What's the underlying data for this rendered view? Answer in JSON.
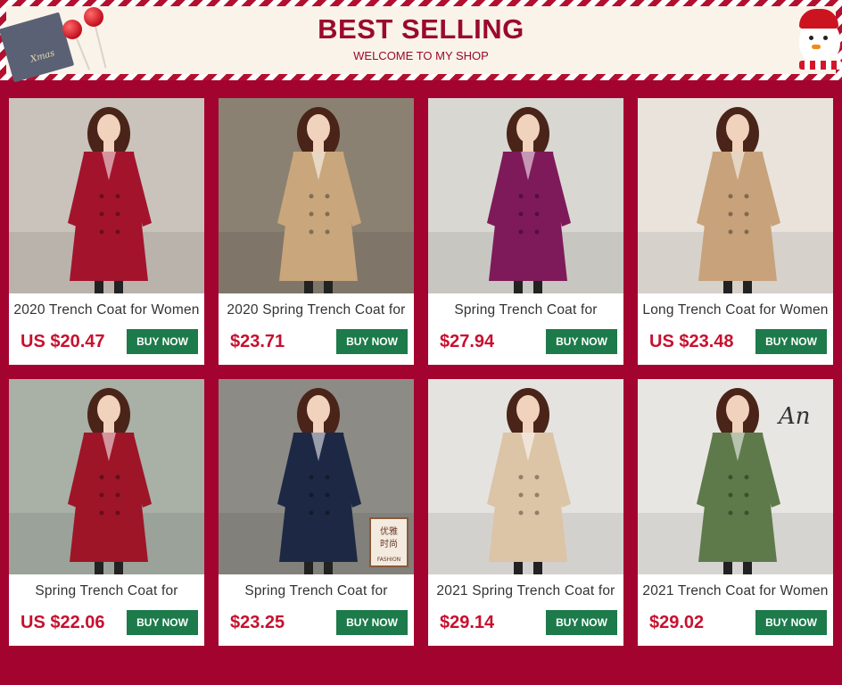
{
  "header": {
    "title": "BEST SELLING",
    "subtitle": "WELCOME TO MY SHOP",
    "deco_text": "Xmas"
  },
  "products": [
    {
      "title": "2020 Trench Coat for Women",
      "price": "US $20.47",
      "button": "BUY NOW",
      "coat": "#a3142c",
      "bg": "#c9c3bb"
    },
    {
      "title": "2020 Spring Trench Coat for",
      "price": "$23.71",
      "button": "BUY NOW",
      "coat": "#c9a67b",
      "bg": "#8a8172"
    },
    {
      "title": "Spring Trench Coat for",
      "price": "$27.94",
      "button": "BUY NOW",
      "coat": "#7e1a5a",
      "bg": "#d9d7d2"
    },
    {
      "title": "Long Trench Coat for Women",
      "price": "US $23.48",
      "button": "BUY NOW",
      "coat": "#c7a27a",
      "bg": "#e9e3dc"
    },
    {
      "title": "Spring Trench Coat for",
      "price": "US $22.06",
      "button": "BUY NOW",
      "coat": "#9e1528",
      "bg": "#a9b0a6"
    },
    {
      "title": "Spring Trench Coat for",
      "price": "$23.25",
      "button": "BUY NOW",
      "coat": "#1d2944",
      "bg": "#8d8b86",
      "badge_line1": "优雅",
      "badge_line2": "时尚",
      "badge_line3": "FASHION"
    },
    {
      "title": "2021 Spring Trench Coat for",
      "price": "$29.14",
      "button": "BUY NOW",
      "coat": "#dcc4a6",
      "bg": "#e5e3e0"
    },
    {
      "title": "2021 Trench Coat for Women",
      "price": "$29.02",
      "button": "BUY NOW",
      "coat": "#5e7a4a",
      "bg": "#e8e6e3",
      "wall_text": "An"
    }
  ],
  "colors": {
    "page_bg": "#a3042f",
    "accent": "#9a0a2d",
    "price": "#c8102e",
    "button": "#1d7a4a"
  }
}
